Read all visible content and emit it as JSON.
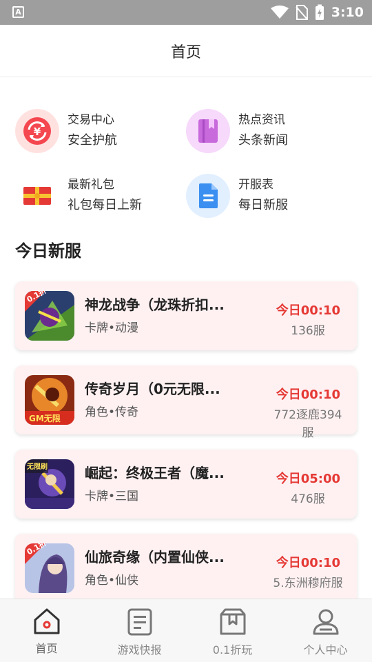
{
  "status_bar": {
    "left_badge": "A",
    "time": "3:10"
  },
  "header": {
    "title": "首页"
  },
  "quick_links": [
    {
      "title": "交易中心",
      "subtitle": "安全护航",
      "icon": "exchange-icon",
      "color": "#f4474f"
    },
    {
      "title": "热点资讯",
      "subtitle": "头条新闻",
      "icon": "bookmark-book-icon",
      "color": "#b45ad9"
    },
    {
      "title": "最新礼包",
      "subtitle": "礼包每日上新",
      "icon": "gift-envelope-icon",
      "color": "#e53935"
    },
    {
      "title": "开服表",
      "subtitle": "每日新服",
      "icon": "document-icon",
      "color": "#3a8ff0"
    }
  ],
  "section": {
    "title": "今日新服"
  },
  "games": [
    {
      "name": "神龙战争（龙珠折扣...",
      "tags": "卡牌•动漫",
      "time": "今日00:10",
      "server": "136服",
      "badge": "0.1折"
    },
    {
      "name": "传奇岁月（0元无限...",
      "tags": "角色•传奇",
      "time": "今日00:10",
      "server": "772逐鹿394服",
      "badge": "GM无限"
    },
    {
      "name": "崛起：终极王者（魔...",
      "tags": "卡牌•三国",
      "time": "今日05:00",
      "server": "476服",
      "badge": "无限刷"
    },
    {
      "name": "仙旅奇缘（内置仙侠...",
      "tags": "角色•仙侠",
      "time": "今日00:10",
      "server": "5.东洲穆府服",
      "badge": "0.1折"
    }
  ],
  "tabs": [
    {
      "label": "首页",
      "icon": "home-icon",
      "active": true
    },
    {
      "label": "游戏快报",
      "icon": "news-document-icon",
      "active": false
    },
    {
      "label": "0.1折玩",
      "icon": "discount-box-icon",
      "active": false
    },
    {
      "label": "个人中心",
      "icon": "user-icon",
      "active": false
    }
  ],
  "colors": {
    "accent_red": "#e53935",
    "card_bg": "#fff1f2",
    "status_bar": "#9e9e9e"
  }
}
